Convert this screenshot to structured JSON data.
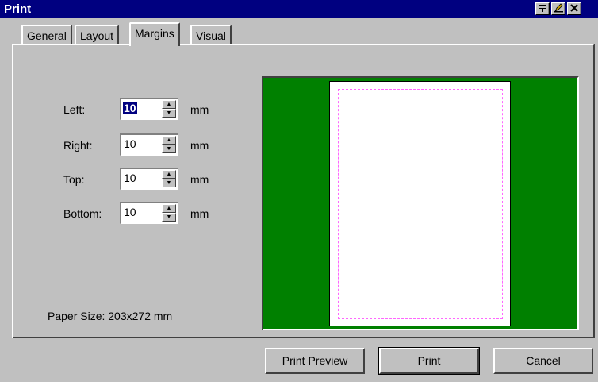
{
  "window": {
    "title": "Print"
  },
  "titlebar_buttons": [
    "pin-icon",
    "edit-icon",
    "close-icon"
  ],
  "tabs": [
    {
      "label": "General",
      "active": false
    },
    {
      "label": "Layout",
      "active": false
    },
    {
      "label": "Margins",
      "active": true
    },
    {
      "label": "Visual",
      "active": false
    }
  ],
  "margins": {
    "left": {
      "label": "Left:",
      "value": "10",
      "unit": "mm",
      "selected": true
    },
    "right": {
      "label": "Right:",
      "value": "10",
      "unit": "mm"
    },
    "top": {
      "label": "Top:",
      "value": "10",
      "unit": "mm"
    },
    "bottom": {
      "label": "Bottom:",
      "value": "10",
      "unit": "mm"
    }
  },
  "paper_size": "Paper Size: 203x272 mm",
  "preview_colors": {
    "background": "#008000",
    "paper": "#ffffff",
    "margin_guides": "#ff66ff"
  },
  "buttons": {
    "print_preview": "Print Preview",
    "print": "Print",
    "cancel": "Cancel"
  }
}
